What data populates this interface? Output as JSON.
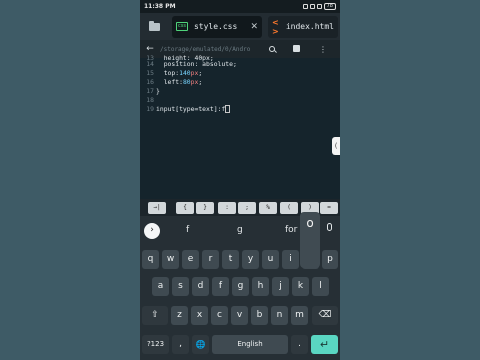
{
  "status_bar": {
    "time": "11:38 PM",
    "battery": "78"
  },
  "tabs": [
    {
      "label": "style.css",
      "icon_text": "css",
      "active": true,
      "close": "✕"
    },
    {
      "label": "index.html",
      "icon_text": "< >",
      "active": false
    }
  ],
  "toolbar": {
    "back": "←",
    "path": "/storage/emulated/0/Andro"
  },
  "editor": {
    "lines": [
      {
        "num": "13",
        "text": "  height: 40px;"
      },
      {
        "num": "14",
        "text": "  position: absolute;"
      },
      {
        "num": "15",
        "text_parts": [
          "  top:",
          "140",
          "px",
          ";"
        ]
      },
      {
        "num": "16",
        "text_parts": [
          "  left:",
          "80",
          "px",
          ";"
        ]
      },
      {
        "num": "17",
        "text": "}"
      },
      {
        "num": "18",
        "text": ""
      },
      {
        "num": "19",
        "text": "input[type=text]:f"
      }
    ],
    "scroll_handle": "("
  },
  "symbol_keys": [
    "→|",
    "{",
    "}",
    ":",
    ";",
    "%",
    "(",
    ")",
    "="
  ],
  "suggestions": {
    "expand": "›",
    "words": [
      "f",
      "g",
      "for"
    ]
  },
  "popup_key": "o",
  "keyboard": {
    "row1": [
      "q",
      "w",
      "e",
      "r",
      "t",
      "y",
      "u",
      "i",
      "o",
      "p"
    ],
    "row1_hints": [
      "1",
      "2",
      "3",
      "4",
      "5",
      "6",
      "7",
      "8",
      "9",
      "0"
    ],
    "row2": [
      "a",
      "s",
      "d",
      "f",
      "g",
      "h",
      "j",
      "k",
      "l"
    ],
    "row3": [
      "z",
      "x",
      "c",
      "v",
      "b",
      "n",
      "m"
    ],
    "shift": "⇧",
    "backspace": "⌫",
    "sym": "?123",
    "comma": ",",
    "globe": "🌐",
    "space": "English",
    "period": ".",
    "enter": "↵"
  }
}
